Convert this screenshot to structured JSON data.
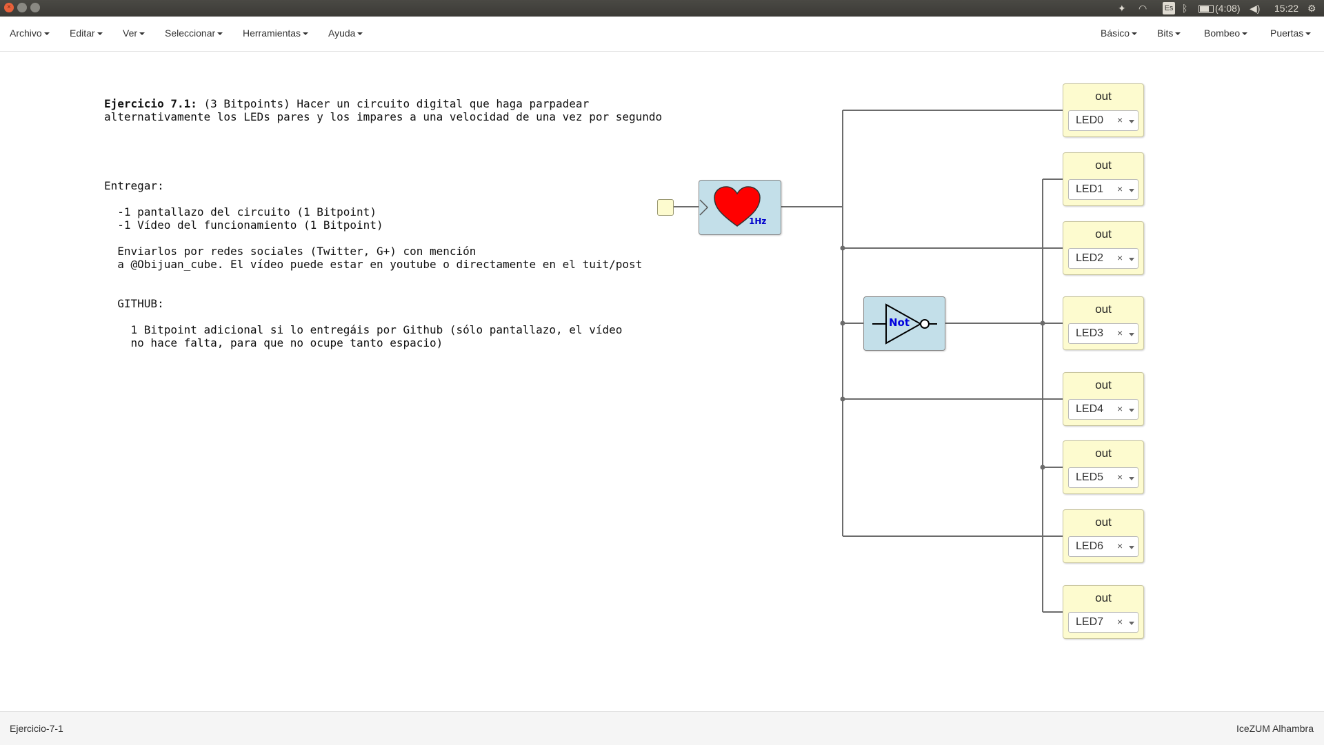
{
  "system_bar": {
    "battery": "(4:08)",
    "clock": "15:22",
    "keyboard": "Es",
    "icons": [
      "dropbox-icon",
      "wifi-icon",
      "keyboard-layout-icon",
      "bluetooth-icon",
      "battery-icon",
      "volume-icon",
      "settings-gear-icon"
    ]
  },
  "menu": {
    "left": [
      "Archivo",
      "Editar",
      "Ver",
      "Seleccionar",
      "Herramientas",
      "Ayuda"
    ],
    "right": [
      "Básico",
      "Bits",
      "Bombeo",
      "Puertas"
    ]
  },
  "notes": {
    "title_bold": "Ejercicio 7.1:",
    "title_rest": " (3 Bitpoints) Hacer un circuito digital que haga parpadear",
    "line2": "alternativamente los LEDs pares y los impares a una velocidad de una vez por segundo",
    "entregar": "Entregar:",
    "item1": "  -1 pantallazo del circuito (1 Bitpoint)",
    "item2": "  -1 Vídeo del funcionamiento (1 Bitpoint)",
    "send1": "  Enviarlos por redes sociales (Twitter, G+) con mención",
    "send2": "  a @Obijuan_cube. El vídeo puede estar en youtube o directamente en el tuit/post",
    "github": "  GITHUB:",
    "gh1": "    1 Bitpoint adicional si lo entregáis por Github (sólo pantallazo, el vídeo",
    "gh2": "    no hace falta, para que no ocupe tanto espacio)"
  },
  "diagram": {
    "heart_label": "1Hz",
    "not_label": "Not",
    "outputs": [
      {
        "label": "out",
        "value": "LED0"
      },
      {
        "label": "out",
        "value": "LED1"
      },
      {
        "label": "out",
        "value": "LED2"
      },
      {
        "label": "out",
        "value": "LED3"
      },
      {
        "label": "out",
        "value": "LED4"
      },
      {
        "label": "out",
        "value": "LED5"
      },
      {
        "label": "out",
        "value": "LED6"
      },
      {
        "label": "out",
        "value": "LED7"
      }
    ],
    "clear_symbol": "×"
  },
  "status": {
    "left": "Ejercicio-7-1",
    "right": "IceZUM Alhambra"
  }
}
